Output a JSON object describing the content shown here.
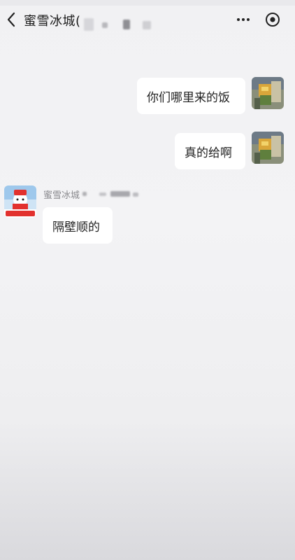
{
  "header": {
    "title": "蜜雪冰城(",
    "back_icon": "chevron-left-icon",
    "more_icon": "more-dots-icon",
    "target_icon": "target-circle-icon"
  },
  "messages": [
    {
      "side": "right",
      "text": "你们哪里来的饭",
      "avatar": "user-avatar"
    },
    {
      "side": "right",
      "text": "真的给啊",
      "avatar": "user-avatar"
    },
    {
      "side": "left",
      "sender": "蜜雪冰城",
      "text": "隔壁顺的",
      "avatar": "shop-logo"
    }
  ],
  "shop_logo": {
    "label": "蜜雪冰城",
    "brand_color": "#e2312e"
  }
}
